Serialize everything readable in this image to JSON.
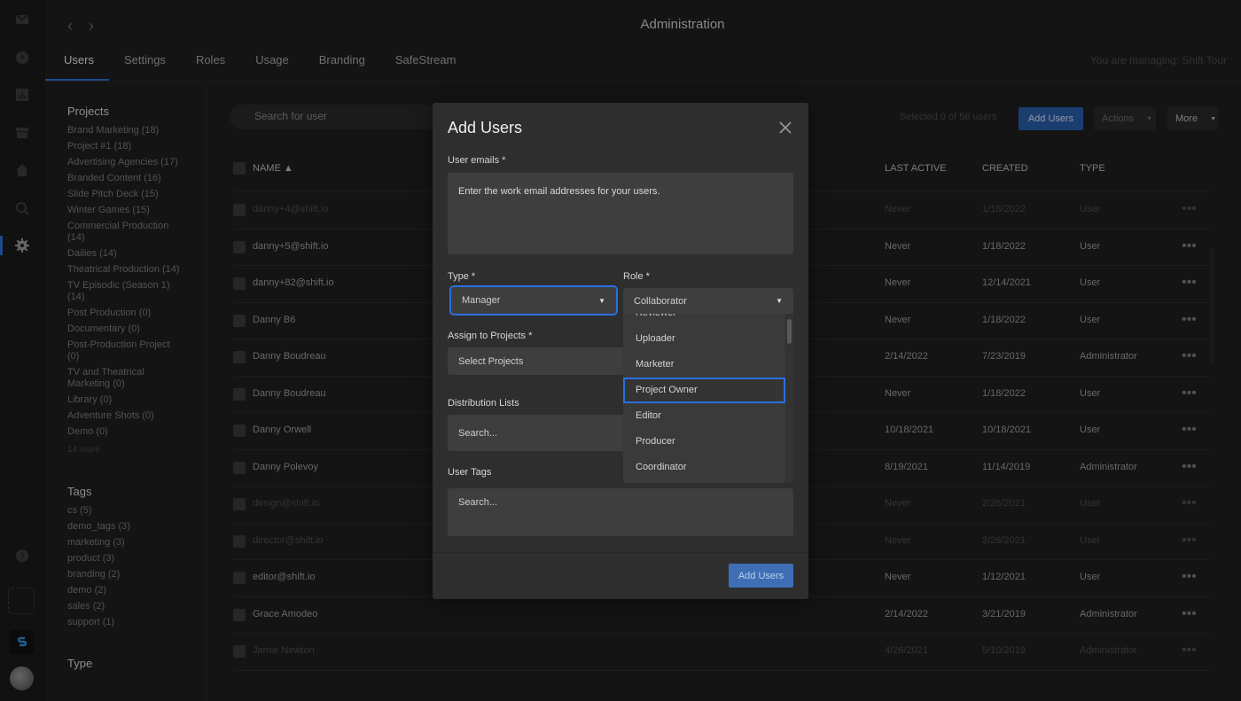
{
  "header": {
    "title": "Administration",
    "managing": "You are managing: Shift Tour",
    "tabs": [
      "Users",
      "Settings",
      "Roles",
      "Usage",
      "Branding",
      "SafeStream"
    ]
  },
  "sidebar": {
    "projects_title": "Projects",
    "projects": [
      "Brand Marketing (18)",
      "Project #1 (18)",
      "Advertising Agencies (17)",
      "Branded Content (16)",
      "Slide Pitch Deck (15)",
      "Winter Games (15)",
      "Commercial Production (14)",
      "Dailies (14)",
      "Theatrical Production (14)",
      "TV Episodic (Season 1) (14)",
      "Post Production (0)",
      "Documentary (0)",
      "Post-Production Project (0)",
      "TV and Theatrical Marketing (0)",
      "Library (0)",
      "Adventure Shots (0)",
      "Demo (0)"
    ],
    "projects_more": "14 more",
    "tags_title": "Tags",
    "tags": [
      "cs (5)",
      "demo_tags (3)",
      "marketing (3)",
      "product (3)",
      "branding (2)",
      "demo (2)",
      "sales (2)",
      "support (1)"
    ],
    "type_title": "Type"
  },
  "toolbar": {
    "search_placeholder": "Search for user",
    "selected_info": "Selected 0 of 56 users",
    "add_users": "Add Users",
    "actions": "Actions",
    "more": "More"
  },
  "table": {
    "headers": {
      "name": "NAME ▲",
      "last_active": "LAST ACTIVE",
      "created": "CREATED",
      "type": "TYPE"
    },
    "rows": [
      {
        "name": "danny+4@shift.io",
        "last_active": "Never",
        "created": "1/18/2022",
        "type": "User",
        "dim": true
      },
      {
        "name": "danny+5@shift.io",
        "last_active": "Never",
        "created": "1/18/2022",
        "type": "User",
        "dim": false
      },
      {
        "name": "danny+82@shift.io",
        "last_active": "Never",
        "created": "12/14/2021",
        "type": "User",
        "dim": false
      },
      {
        "name": "Danny B6",
        "last_active": "Never",
        "created": "1/18/2022",
        "type": "User",
        "dim": false
      },
      {
        "name": "Danny Boudreau",
        "last_active": "2/14/2022",
        "created": "7/23/2019",
        "type": "Administrator",
        "dim": false
      },
      {
        "name": "Danny Boudreau",
        "last_active": "Never",
        "created": "1/18/2022",
        "type": "User",
        "dim": false
      },
      {
        "name": "Danny Orwell",
        "last_active": "10/18/2021",
        "created": "10/18/2021",
        "type": "User",
        "dim": false
      },
      {
        "name": "Danny Polevoy",
        "last_active": "8/19/2021",
        "created": "11/14/2019",
        "type": "Administrator",
        "dim": false
      },
      {
        "name": "design@shift.io",
        "last_active": "Never",
        "created": "2/26/2021",
        "type": "User",
        "dim": true
      },
      {
        "name": "director@shift.io",
        "last_active": "Never",
        "created": "2/26/2021",
        "type": "User",
        "dim": true
      },
      {
        "name": "editor@shift.io",
        "last_active": "Never",
        "created": "1/12/2021",
        "type": "User",
        "dim": false
      },
      {
        "name": "Grace Amodeo",
        "last_active": "2/14/2022",
        "created": "3/21/2019",
        "type": "Administrator",
        "dim": false
      },
      {
        "name": "Jamie Newton",
        "last_active": "4/26/2021",
        "created": "5/10/2019",
        "type": "Administrator",
        "dim": true
      }
    ],
    "row_menu": "•••"
  },
  "modal": {
    "title": "Add Users",
    "emails_label": "User emails *",
    "emails_placeholder": "Enter the work email addresses for your users.",
    "type_label": "Type *",
    "type_value": "Manager",
    "role_label": "Role *",
    "role_value": "Collaborator",
    "assign_label": "Assign to Projects *",
    "assign_value": "Select Projects",
    "dist_label": "Distribution Lists",
    "dist_placeholder": "Search...",
    "tags_label": "User Tags",
    "tags_placeholder": "Search...",
    "submit": "Add Users",
    "role_options": [
      "Reviewer",
      "Uploader",
      "Marketer",
      "Project Owner",
      "Editor",
      "Producer",
      "Coordinator"
    ],
    "highlighted_option": "Project Owner"
  }
}
